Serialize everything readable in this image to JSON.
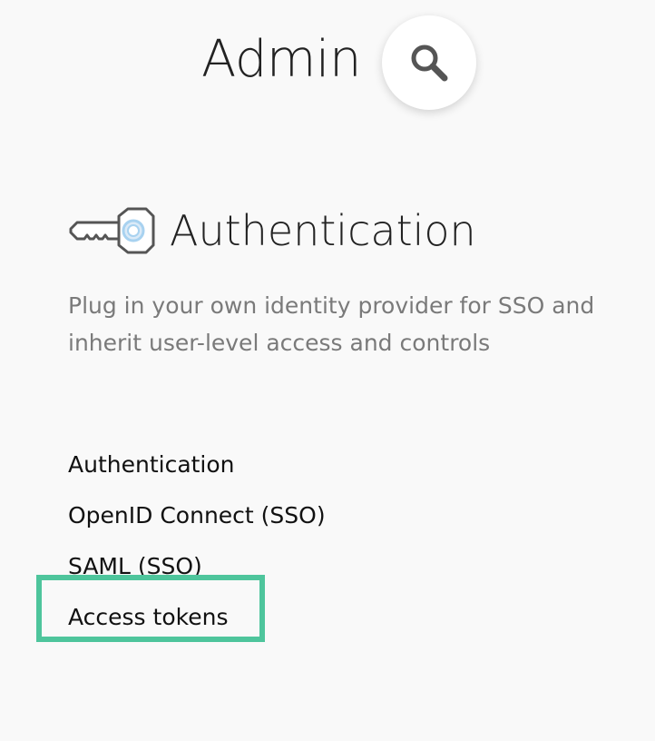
{
  "header": {
    "title": "Admin",
    "search_icon": "search-icon"
  },
  "section": {
    "icon": "key-icon",
    "title": "Authentication",
    "description": "Plug in your own identity provider for SSO and inherit user-level access and controls"
  },
  "menu": {
    "items": [
      {
        "label": "Authentication"
      },
      {
        "label": "OpenID Connect (SSO)"
      },
      {
        "label": "SAML (SSO)"
      },
      {
        "label": "Access tokens",
        "highlighted": true
      }
    ]
  },
  "colors": {
    "background": "#f9f9f9",
    "highlight": "#4ec59c",
    "key_accent": "#a8d2f0",
    "description_text": "#7a7a7a"
  }
}
